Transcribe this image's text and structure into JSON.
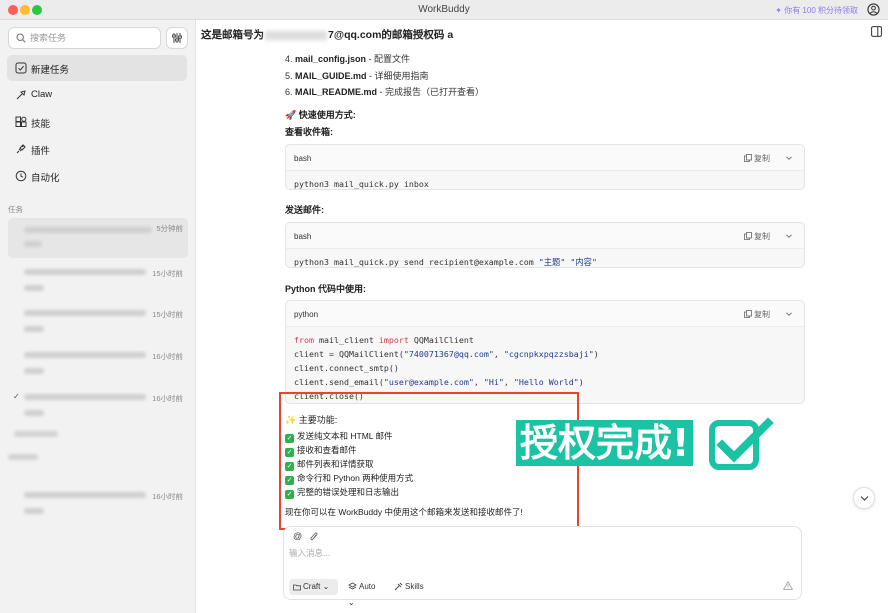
{
  "window": {
    "title": "WorkBuddy",
    "promo": "你有 100 积分待领取"
  },
  "sidebar": {
    "search_placeholder": "搜索任务",
    "nav": [
      {
        "label": "新建任务",
        "icon": "new-task-icon"
      },
      {
        "label": "Claw",
        "icon": "claw-icon"
      },
      {
        "label": "技能",
        "icon": "skills-icon"
      },
      {
        "label": "插件",
        "icon": "plugin-icon"
      },
      {
        "label": "自动化",
        "icon": "clock-icon"
      }
    ],
    "tasks_label": "任务",
    "tasks": [
      {
        "time": "5分钟前"
      },
      {
        "time": "15小时前"
      },
      {
        "time": "15小时前"
      },
      {
        "time": "16小时前"
      },
      {
        "time": "16小时前"
      },
      {
        "time": "16小时前"
      }
    ]
  },
  "header": {
    "title_prefix": "这是邮箱号为",
    "title_suffix": "7@qq.com的邮箱授权码 a"
  },
  "content": {
    "files": [
      {
        "num": "4.",
        "name": "mail_config.json",
        "desc": " - 配置文件"
      },
      {
        "num": "5.",
        "name": "MAIL_GUIDE.md",
        "desc": " - 详细使用指南"
      },
      {
        "num": "6.",
        "name": "MAIL_README.md",
        "desc": " - 完成报告（已打开查看）"
      }
    ],
    "quick_use": "🚀 快速使用方式:",
    "check_inbox": "查看收件箱:",
    "send_mail": "发送邮件:",
    "python_use": "Python 代码中使用:",
    "copy_label": "复制",
    "code_blocks": [
      {
        "lang": "bash",
        "lines": [
          "python3 mail_quick.py inbox"
        ]
      },
      {
        "lang": "bash",
        "lines": [
          "python3 mail_quick.py send recipient@example.com \"主题\" \"内容\""
        ]
      },
      {
        "lang": "python",
        "lines": [
          "from mail_client import QQMailClient",
          "client = QQMailClient(\"740071367@qq.com\", \"cgcnpkxpqzzsbaji\")",
          "client.connect_smtp()",
          "client.send_email(\"user@example.com\", \"Hi\", \"Hello World\")",
          "client.close()"
        ]
      }
    ],
    "features_title": "✨ 主要功能:",
    "features": [
      "发送纯文本和 HTML 邮件",
      "接收和查看邮件",
      "邮件列表和详情获取",
      "命令行和 Python 两种使用方式",
      "完整的错误处理和日志输出"
    ],
    "closing": "现在你可以在 WorkBuddy 中使用这个邮箱来发送和接收邮件了!"
  },
  "overlay": {
    "stamp_text": "授权完成!"
  },
  "composer": {
    "attach": "@",
    "placeholder": "输入消息...",
    "craft": "Craft",
    "auto": "Auto",
    "skills": "Skills"
  },
  "colors": {
    "accent_teal": "#19c3a3",
    "highlight_red": "#e8452c",
    "check_green": "#2bb24c",
    "promo_purple": "#8a7de8"
  }
}
